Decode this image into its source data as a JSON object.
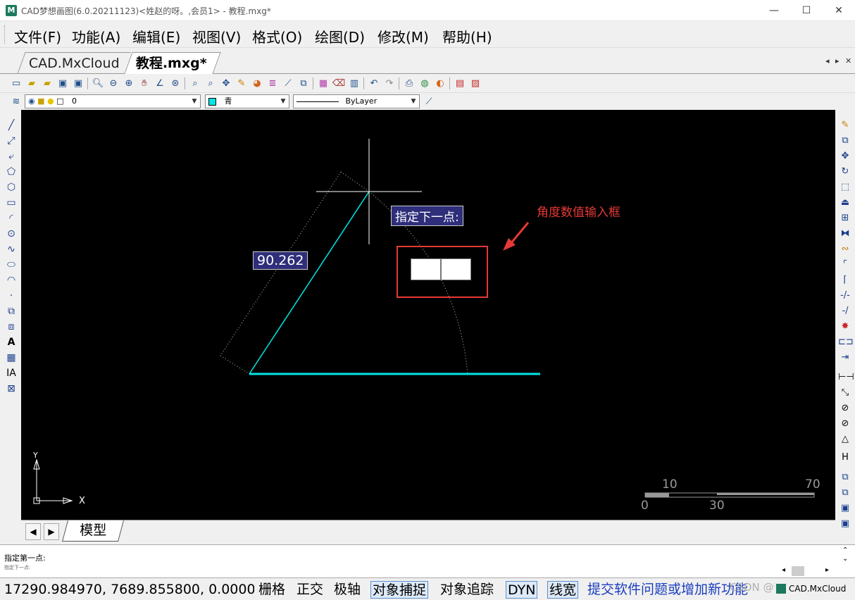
{
  "window": {
    "title": "CAD梦想画图(6.0.20211123)<姓赵的呀。,会员1> - 教程.mxg*",
    "app_icon": "M",
    "minimize": "—",
    "maximize": "☐",
    "close": "✕"
  },
  "menu": [
    "文件(F)",
    "功能(A)",
    "编辑(E)",
    "视图(V)",
    "格式(O)",
    "绘图(D)",
    "修改(M)",
    "帮助(H)"
  ],
  "doc_tabs": [
    "CAD.MxCloud",
    "教程.mxg*"
  ],
  "toolbar": {
    "layer_value": "0",
    "color_value": "青",
    "linetype_value": "ByLayer"
  },
  "canvas": {
    "prompt_label": "指定下一点:",
    "length_label": "90.262",
    "annotation": "角度数值输入框",
    "ucs_y": "Y",
    "ucs_x": "X",
    "scale_top": [
      "10",
      "70"
    ],
    "scale_bottom": [
      "0",
      "30"
    ],
    "colors": {
      "line": "#00e5e5",
      "annotation": "#e53935",
      "prompt_bg": "#2e2e7a"
    }
  },
  "layout_tab": "模型",
  "command": {
    "line1": "指定第一点:",
    "line2": "指定下一点:"
  },
  "status": {
    "coords": "17290.984970,  7689.855800,  0.0000",
    "toggles": [
      {
        "label": "栅格",
        "on": false
      },
      {
        "label": "正交",
        "on": false
      },
      {
        "label": "极轴",
        "on": false
      },
      {
        "label": "对象捕捉",
        "on": true
      },
      {
        "label": "对象追踪",
        "on": false
      },
      {
        "label": "DYN",
        "on": true
      },
      {
        "label": "线宽",
        "on": true
      }
    ],
    "feedback_link": "提交软件问题或增加新功能",
    "watermark": "CSDN @梦想CAD软件",
    "brand": "CAD.MxCloud"
  }
}
